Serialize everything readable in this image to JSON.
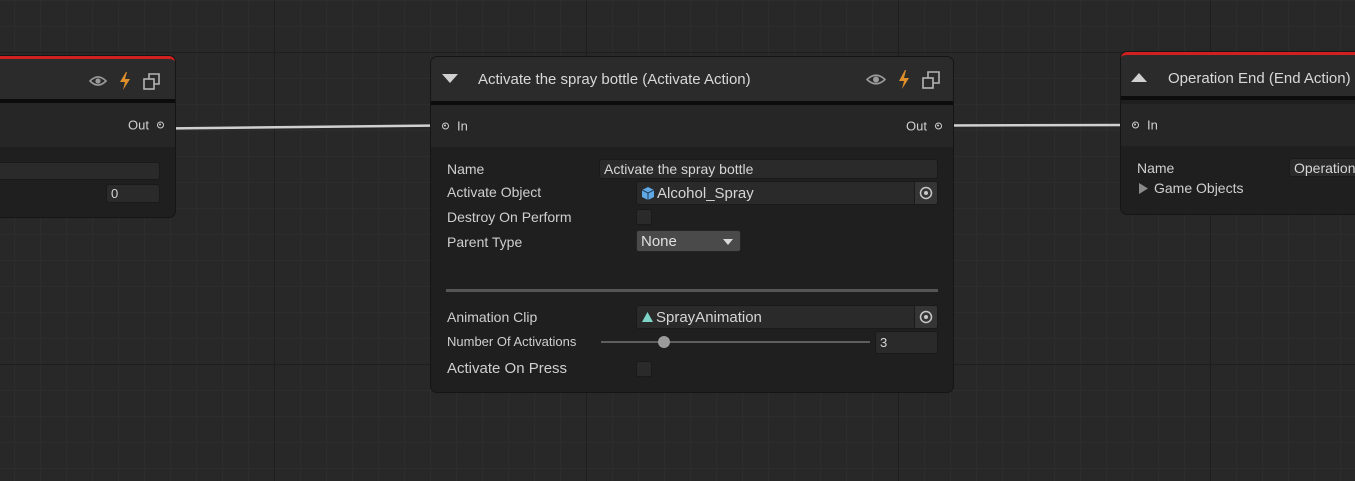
{
  "left_node": {
    "out_label": "Out",
    "value_field": "",
    "number_field": "0"
  },
  "main_node": {
    "title": "Activate the spray bottle (Activate Action)",
    "in_label": "In",
    "out_label": "Out",
    "fields": {
      "name_label": "Name",
      "name_value": "Activate the spray bottle",
      "activate_object_label": "Activate Object",
      "activate_object_value": "Alcohol_Spray",
      "destroy_on_perform_label": "Destroy On Perform",
      "destroy_on_perform_checked": false,
      "parent_type_label": "Parent Type",
      "parent_type_value": "None",
      "animation_clip_label": "Animation Clip",
      "animation_clip_value": "SprayAnimation",
      "number_of_activations_label": "Number Of Activations",
      "number_of_activations_value": "3",
      "activate_on_press_label": "Activate On Press",
      "activate_on_press_checked": false
    }
  },
  "right_node": {
    "title": "Operation End (End Action)",
    "in_label": "In",
    "name_label": "Name",
    "name_value": "Operation End",
    "game_objects_label": "Game Objects"
  },
  "colors": {
    "canvas": "#282828",
    "node_body": "#1f1f1f",
    "node_header": "#2b2b2b",
    "error_stripe": "#d12020",
    "lightning": "#e0902a",
    "edge": "#d0d0d0"
  },
  "icons": [
    "eye-icon",
    "lightning-icon",
    "prefab-icon",
    "collapse-triangle-icon",
    "expand-triangle-icon",
    "cube-icon",
    "animation-clip-icon",
    "object-picker-icon",
    "dropdown-arrow-icon",
    "foldout-arrow-icon"
  ]
}
